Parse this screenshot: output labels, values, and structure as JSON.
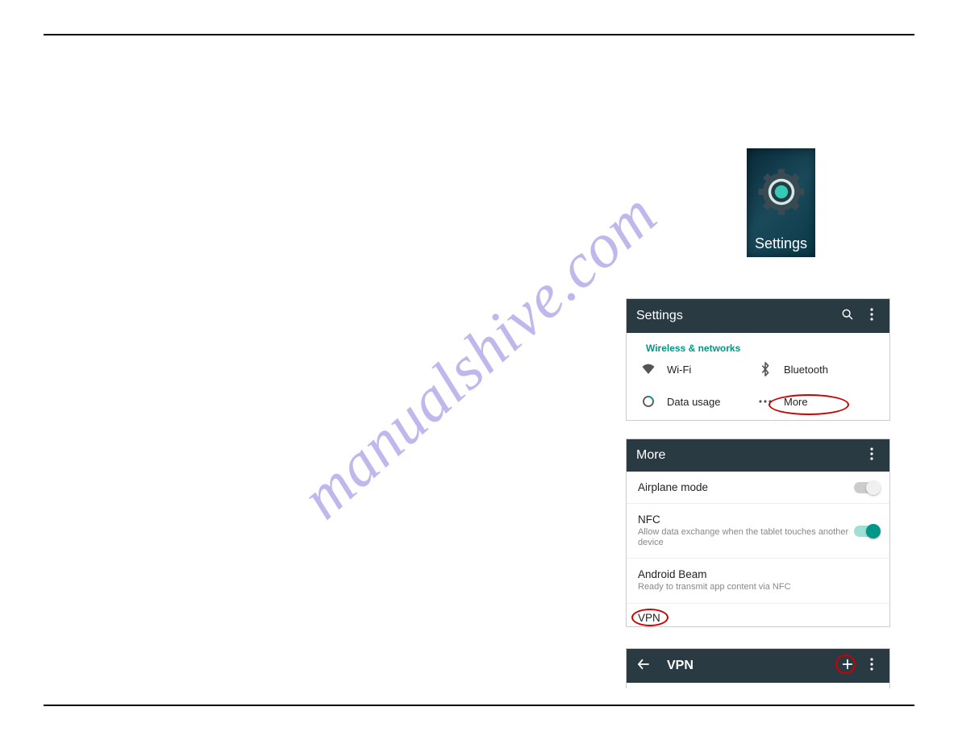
{
  "watermark_text": "manualshive.com",
  "settings_icon": {
    "label": "Settings"
  },
  "settings_card": {
    "appbar_title": "Settings",
    "section_header": "Wireless & networks",
    "items": {
      "wifi": "Wi-Fi",
      "bluetooth": "Bluetooth",
      "data_usage": "Data usage",
      "more": "More"
    }
  },
  "more_card": {
    "appbar_title": "More",
    "rows": {
      "airplane": {
        "title": "Airplane mode"
      },
      "nfc": {
        "title": "NFC",
        "subtitle": "Allow data exchange when the tablet touches another device"
      },
      "beam": {
        "title": "Android Beam",
        "subtitle": "Ready to transmit app content via NFC"
      },
      "vpn": {
        "title": "VPN"
      }
    }
  },
  "vpn_card": {
    "appbar_title": "VPN"
  },
  "colors": {
    "appbar_bg": "#2a3a42",
    "teal": "#009688",
    "highlight_red": "#cc0000"
  }
}
